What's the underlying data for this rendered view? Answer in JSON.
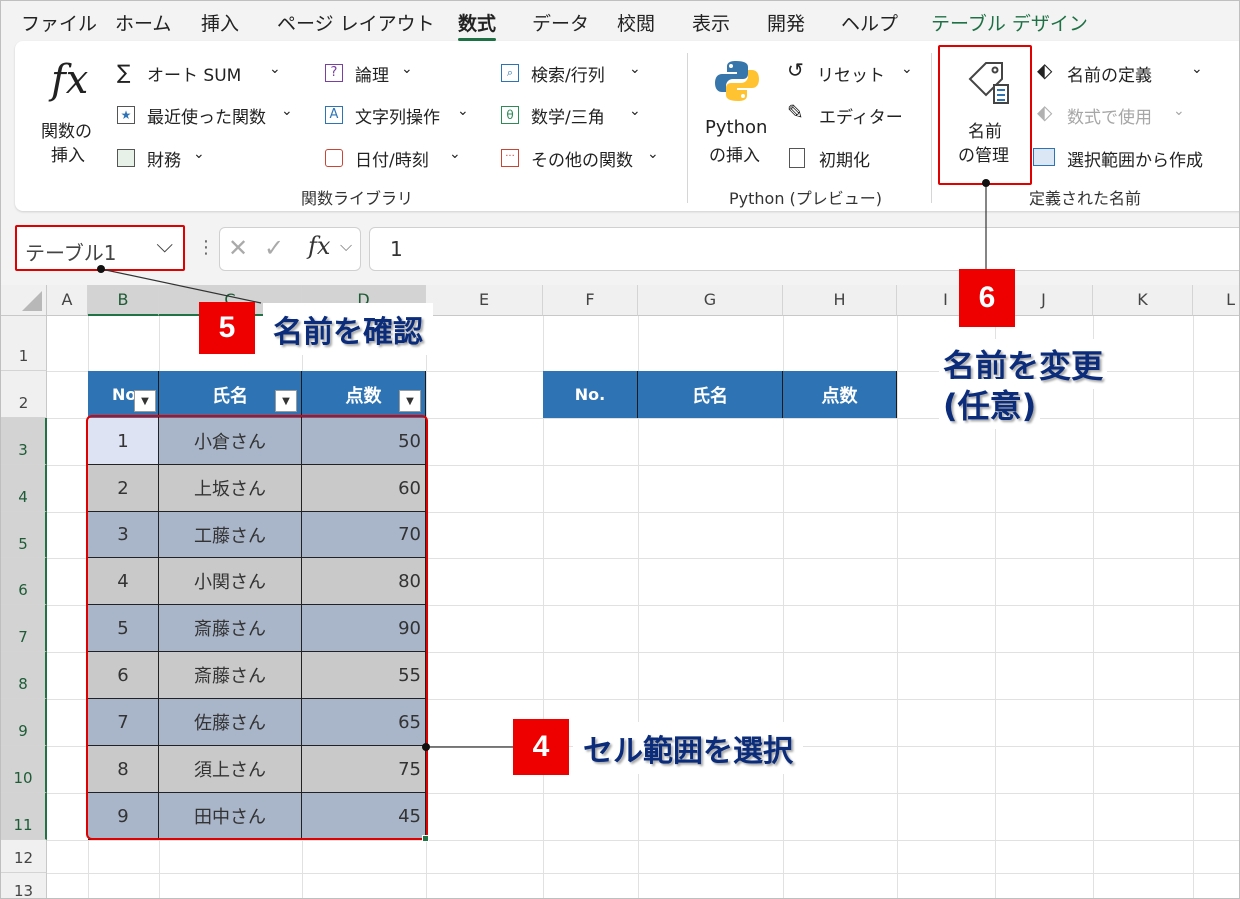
{
  "menu": [
    "ファイル",
    "ホーム",
    "挿入",
    "ページ レイアウト",
    "数式",
    "データ",
    "校閲",
    "表示",
    "開発",
    "ヘルプ",
    "テーブル デザイン"
  ],
  "ribbon": {
    "insert_function": {
      "icon": "fx",
      "label1": "関数の",
      "label2": "挿入"
    },
    "autosum": "オート SUM",
    "recent": "最近使った関数",
    "finance": "財務",
    "logical": "論理",
    "text": "文字列操作",
    "datetime": "日付/時刻",
    "lookup": "検索/行列",
    "math": "数学/三角",
    "more": "その他の関数",
    "function_library": "関数ライブラリ",
    "python_insert1": "Python",
    "python_insert2": "の挿入",
    "reset": "リセット",
    "editor": "エディター",
    "initialize": "初期化",
    "python_group": "Python (プレビュー)",
    "name_manager1": "名前",
    "name_manager2": "の管理",
    "define_name": "名前の定義",
    "use_in_formula": "数式で使用",
    "create_from_selection": "選択範囲から作成",
    "defined_names": "定義された名前"
  },
  "formula_bar": {
    "name_box": "テーブル1",
    "fx": "fx",
    "value": "1"
  },
  "columns": [
    "A",
    "B",
    "C",
    "D",
    "E",
    "F",
    "G",
    "H",
    "I",
    "J",
    "K",
    "L"
  ],
  "rows": [
    "1",
    "2",
    "3",
    "4",
    "5",
    "6",
    "7",
    "8",
    "9",
    "10",
    "11",
    "12",
    "13"
  ],
  "table1": {
    "headers": [
      "No",
      "氏名",
      "点数"
    ],
    "rows": [
      [
        "1",
        "小倉さん",
        "50"
      ],
      [
        "2",
        "上坂さん",
        "60"
      ],
      [
        "3",
        "工藤さん",
        "70"
      ],
      [
        "4",
        "小関さん",
        "80"
      ],
      [
        "5",
        "斎藤さん",
        "90"
      ],
      [
        "6",
        "斎藤さん",
        "55"
      ],
      [
        "7",
        "佐藤さん",
        "65"
      ],
      [
        "8",
        "須上さん",
        "75"
      ],
      [
        "9",
        "田中さん",
        "45"
      ]
    ]
  },
  "table2": {
    "headers": [
      "No.",
      "氏名",
      "点数"
    ]
  },
  "callouts": {
    "c4": {
      "num": "4",
      "text": "セル範囲を選択"
    },
    "c5": {
      "num": "5",
      "text": "名前を確認"
    },
    "c6": {
      "num": "6",
      "text1": "名前を変更",
      "text2": "(任意)"
    }
  },
  "colors": {
    "accent": "#217346",
    "table_header": "#2e74b5",
    "callout_red": "#ee0000",
    "callout_text": "#0b2c7a"
  }
}
